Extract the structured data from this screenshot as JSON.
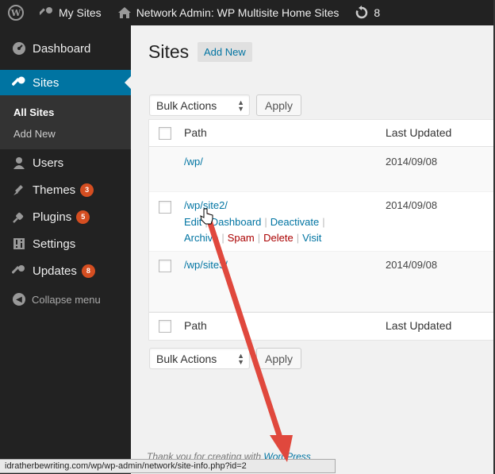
{
  "admin_bar": {
    "my_sites": "My Sites",
    "network_admin": "Network Admin: WP Multisite Home Sites",
    "updates_count": "8"
  },
  "sidebar": {
    "items": [
      {
        "label": "Dashboard",
        "icon": "dashboard-icon"
      },
      {
        "label": "Sites",
        "icon": "wrench-icon"
      },
      {
        "label": "Users",
        "icon": "users-icon"
      },
      {
        "label": "Themes",
        "icon": "brush-icon",
        "badge": "3"
      },
      {
        "label": "Plugins",
        "icon": "plug-icon",
        "badge": "5"
      },
      {
        "label": "Settings",
        "icon": "settings-icon"
      },
      {
        "label": "Updates",
        "icon": "wrench-icon",
        "badge": "8"
      }
    ],
    "submenu": [
      "All Sites",
      "Add New"
    ],
    "collapse": "Collapse menu"
  },
  "main": {
    "title": "Sites",
    "add_new": "Add New",
    "bulk_actions": "Bulk Actions",
    "apply": "Apply",
    "columns": {
      "path": "Path",
      "last_updated": "Last Updated"
    },
    "rows": [
      {
        "path": "/wp/",
        "date": "2014/09/08"
      },
      {
        "path": "/wp/site2/",
        "date": "2014/09/08",
        "actions": {
          "edit": "Edit",
          "dashboard": "Dashboard",
          "deactivate": "Deactivate",
          "archive": "Archive",
          "spam": "Spam",
          "delete": "Delete",
          "visit": "Visit"
        }
      },
      {
        "path": "/wp/site3/",
        "date": "2014/09/08"
      }
    ],
    "footer_text": "Thank you for creating with",
    "footer_link": "WordPress"
  },
  "status_bar": {
    "url": "idratherbewriting.com/wp/wp-admin/network/site-info.php?id=2"
  },
  "colors": {
    "accent": "#0074a2",
    "badge": "#d54e21",
    "annotation_arrow": "#e0483d"
  }
}
